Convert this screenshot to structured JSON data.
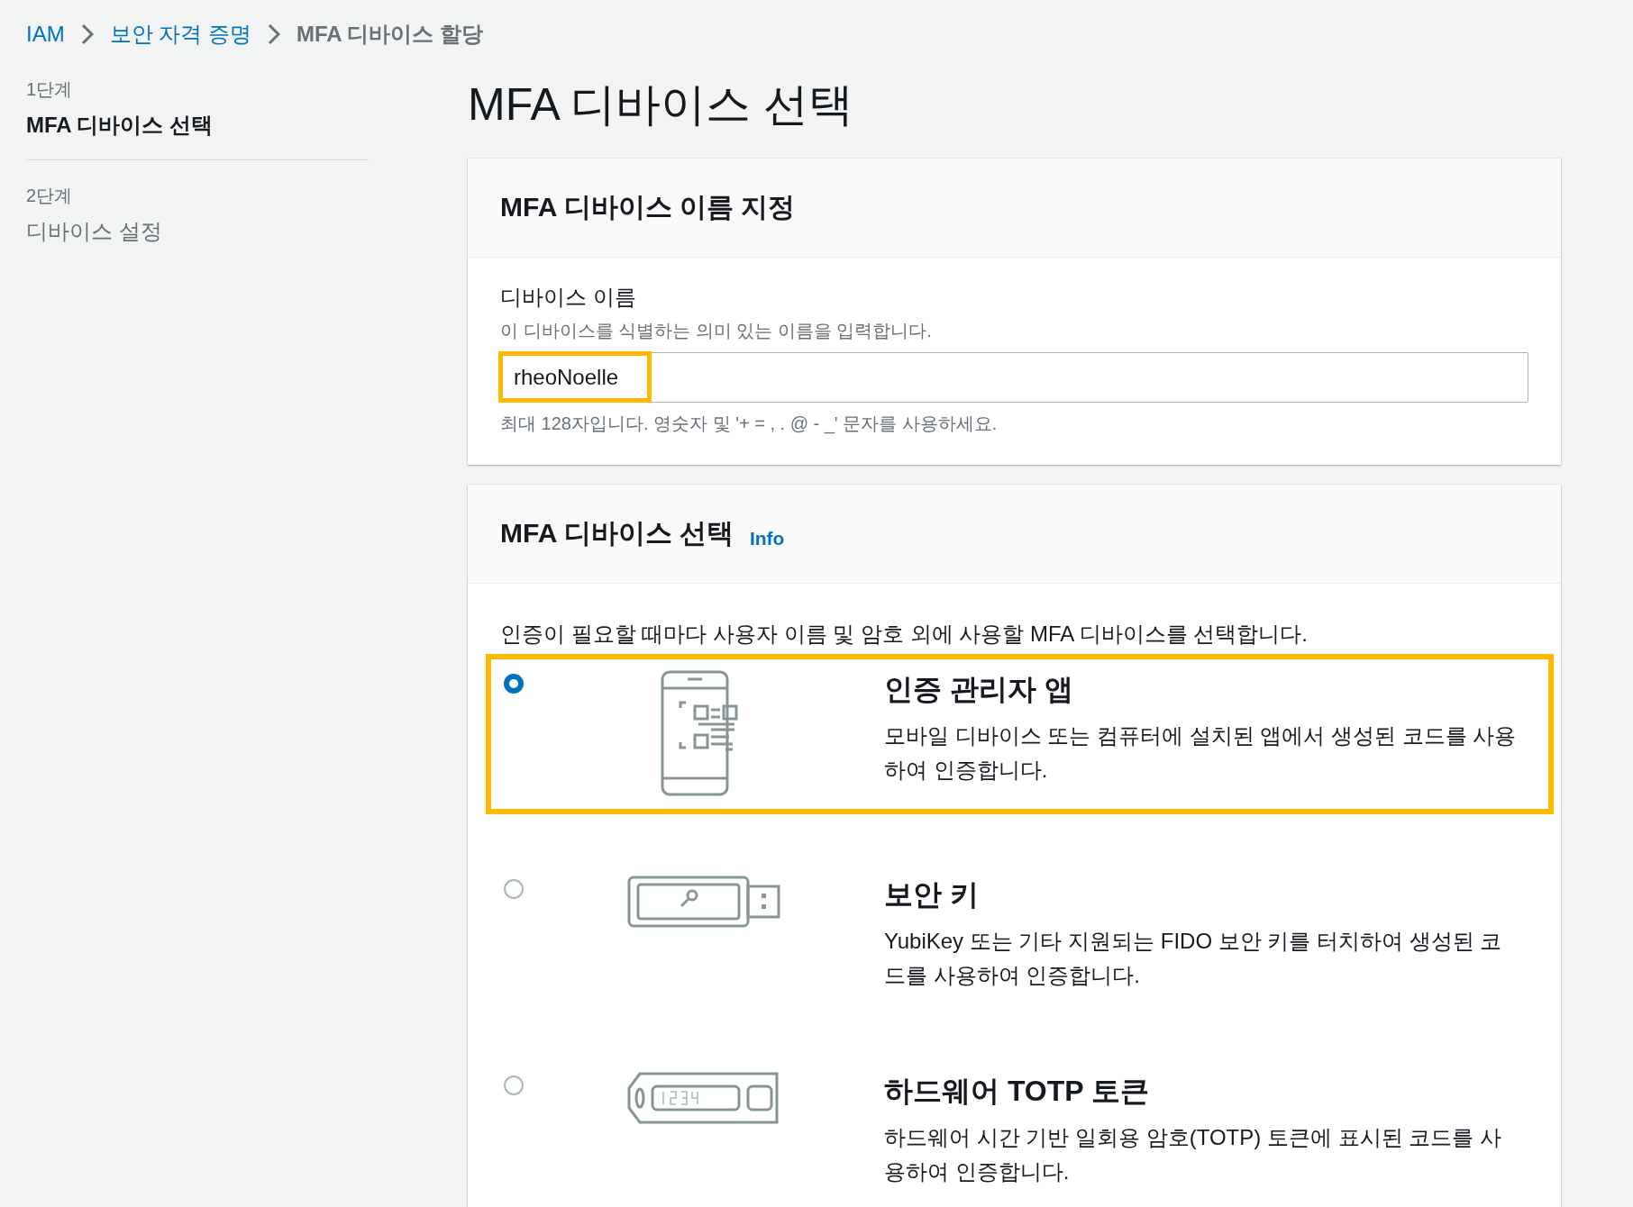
{
  "breadcrumb": [
    {
      "label": "IAM",
      "kind": "link"
    },
    {
      "label": "보안 자격 증명",
      "kind": "link"
    },
    {
      "label": "MFA 디바이스 할당",
      "kind": "current"
    }
  ],
  "steps": [
    {
      "step": "1단계",
      "title": "MFA 디바이스 선택",
      "selected": true
    },
    {
      "step": "2단계",
      "title": "디바이스 설정",
      "selected": false
    }
  ],
  "page_title": "MFA 디바이스 선택",
  "name_panel": {
    "title": "MFA 디바이스 이름 지정",
    "label": "디바이스 이름",
    "description": "이 디바이스를 식별하는 의미 있는 이름을 입력합니다.",
    "value": "rheoNoelle",
    "highlighted": true,
    "constraint": "최대 128자입니다. 영숫자 및 '+ = , . @ - _' 문자를 사용하세요."
  },
  "device_panel": {
    "title": "MFA 디바이스 선택",
    "info_link": "Info",
    "description": "인증이 필요할 때마다 사용자 이름 및 암호 외에 사용할 MFA 디바이스를 선택합니다.",
    "options": [
      {
        "kind": "phone",
        "title": "인증 관리자 앱",
        "description": "모바일 디바이스 또는 컴퓨터에 설치된 앱에서 생성된 코드를 사용하여 인증합니다.",
        "selected": true,
        "highlighted": true
      },
      {
        "kind": "usb",
        "title": "보안 키",
        "description": "YubiKey 또는 기타 지원되는 FIDO 보안 키를 터치하여 생성된 코드를 사용하여 인증합니다.",
        "selected": false,
        "highlighted": false
      },
      {
        "kind": "token",
        "title": "하드웨어 TOTP 토큰",
        "description": "하드웨어 시간 기반 일회용 암호(TOTP) 토큰에 표시된 코드를 사용하여 인증합니다.",
        "selected": false,
        "highlighted": false
      }
    ]
  }
}
